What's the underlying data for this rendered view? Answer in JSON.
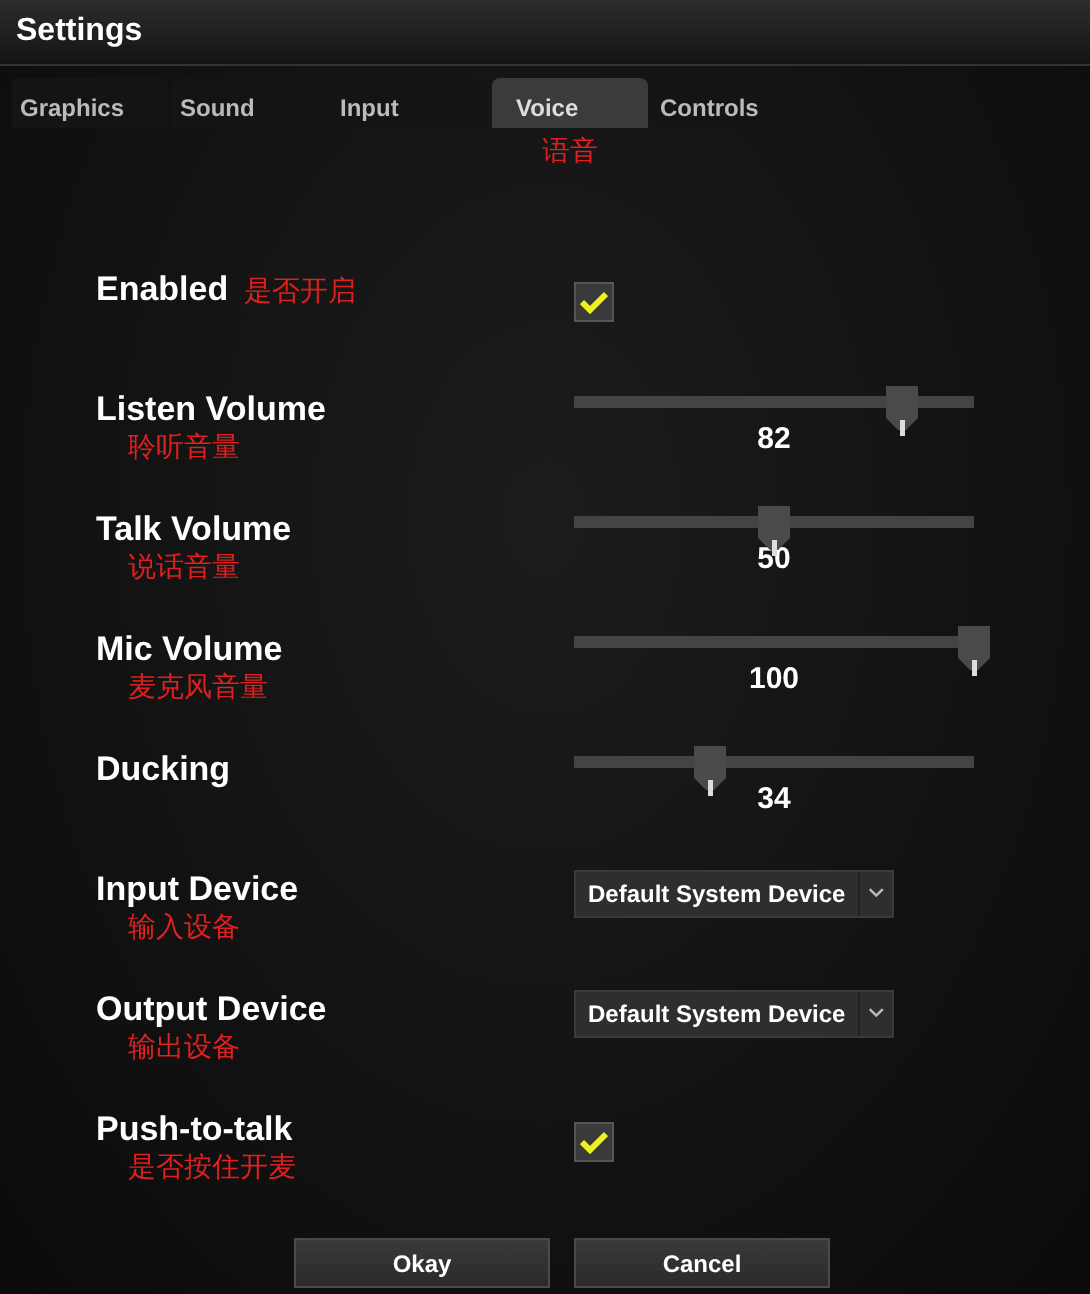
{
  "window": {
    "title": "Settings"
  },
  "tabs": [
    {
      "label": "Graphics",
      "selected": false
    },
    {
      "label": "Sound",
      "selected": false
    },
    {
      "label": "Input",
      "selected": false
    },
    {
      "label": "Voice",
      "selected": true,
      "note": "语音"
    },
    {
      "label": "Controls",
      "selected": false
    }
  ],
  "rows": [
    {
      "kind": "checkbox",
      "label": "Enabled",
      "note": "是否开启",
      "checked": true
    },
    {
      "kind": "slider",
      "label": "Listen Volume",
      "note": "聆听音量",
      "level": 0.82,
      "reading": "82"
    },
    {
      "kind": "slider",
      "label": "Talk Volume",
      "note": "说话音量",
      "level": 0.5,
      "reading": "50"
    },
    {
      "kind": "slider",
      "label": "Mic Volume",
      "note": "麦克风音量",
      "level": 1,
      "reading": "100"
    },
    {
      "kind": "slider",
      "label": "Ducking",
      "level": 0.34,
      "reading": "34"
    },
    {
      "kind": "dropdown",
      "label": "Input Device",
      "note": "输入设备",
      "value": "Default System Device"
    },
    {
      "kind": "dropdown",
      "label": "Output Device",
      "note": "输出设备",
      "value": "Default System Device"
    },
    {
      "kind": "checkbox",
      "label": "Push-to-talk",
      "note": "是否按住开麦",
      "checked": true
    }
  ],
  "buttons": [
    "Okay",
    "Cancel"
  ]
}
